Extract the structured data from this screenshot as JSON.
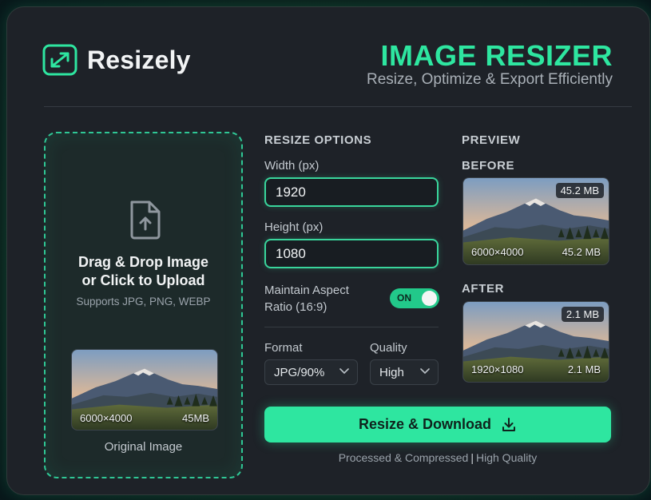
{
  "brand": {
    "name": "Resizely"
  },
  "header": {
    "title": "IMAGE RESIZER",
    "subtitle": "Resize, Optimize & Export Efficiently"
  },
  "upload": {
    "title_line1": "Drag & Drop Image",
    "title_line2": "or Click to Upload",
    "supports": "Supports JPG, PNG, WEBP",
    "original": {
      "dimensions": "6000×4000",
      "size": "45MB",
      "caption": "Original Image"
    }
  },
  "options": {
    "section": "RESIZE OPTIONS",
    "width_label": "Width (px)",
    "width_value": "1920",
    "height_label": "Height (px)",
    "height_value": "1080",
    "aspect_line1": "Maintain Aspect",
    "aspect_line2": "Ratio (16:9)",
    "aspect_toggle": "ON",
    "format_label": "Format",
    "format_value": "JPG/90%",
    "quality_label": "Quality",
    "quality_value": "High"
  },
  "preview": {
    "section": "PREVIEW",
    "before": {
      "label": "BEFORE",
      "badge": "45.2 MB",
      "dimensions": "6000×4000",
      "size": "45.2 MB"
    },
    "after": {
      "label": "AFTER",
      "badge": "2.1 MB",
      "dimensions": "1920×1080",
      "size": "2.1 MB"
    }
  },
  "action": {
    "label": "Resize & Download",
    "footnote_left": "Processed & Compressed",
    "footnote_sep": "|",
    "footnote_right": "High Quality"
  },
  "colors": {
    "accent": "#2ee6a0",
    "panel": "#1e2228",
    "border_accent": "#39d59c"
  },
  "icons": {
    "brand": "resize-arrows-icon",
    "upload": "file-upload-icon",
    "download": "download-icon",
    "dropdown": "chevron-down-icon"
  }
}
